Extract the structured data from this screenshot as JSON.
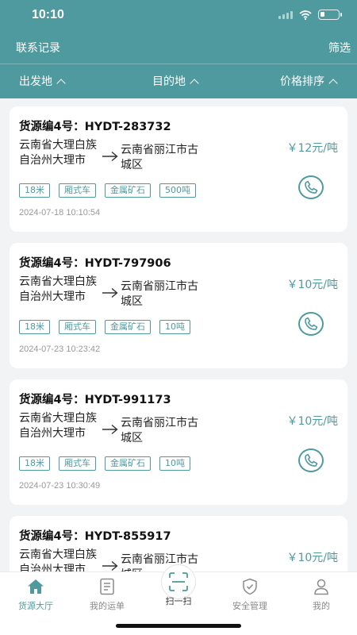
{
  "status_bar": {
    "time": "10:10"
  },
  "nav": {
    "left": "联系记录",
    "right": "筛选"
  },
  "filters": [
    {
      "label": "出发地"
    },
    {
      "label": "目的地"
    },
    {
      "label": "价格排序"
    }
  ],
  "cards": [
    {
      "title": "货源编4号：HYDT-283732",
      "origin": "云南省大理白族自治州大理市",
      "destination": "云南省丽江市古城区",
      "price": "￥12元/吨",
      "tags": [
        "18米",
        "厢式车",
        "金属矿石",
        "500吨"
      ],
      "time": "2024-07-18 10:10:54"
    },
    {
      "title": "货源编4号：HYDT-797906",
      "origin": "云南省大理白族自治州大理市",
      "destination": "云南省丽江市古城区",
      "price": "￥10元/吨",
      "tags": [
        "18米",
        "厢式车",
        "金属矿石",
        "10吨"
      ],
      "time": "2024-07-23 10:23:42"
    },
    {
      "title": "货源编4号：HYDT-991173",
      "origin": "云南省大理白族自治州大理市",
      "destination": "云南省丽江市古城区",
      "price": "￥10元/吨",
      "tags": [
        "18米",
        "厢式车",
        "金属矿石",
        "10吨"
      ],
      "time": "2024-07-23 10:30:49"
    },
    {
      "title": "货源编4号：HYDT-855917",
      "origin": "云南省大理白族自治州大理市",
      "destination": "云南省丽江市古城区",
      "price": "￥10元/吨",
      "tags": [],
      "time": ""
    }
  ],
  "tabbar": {
    "items": [
      {
        "label": "货源大厅",
        "icon": "home-icon",
        "active": true
      },
      {
        "label": "我的运单",
        "icon": "document-icon",
        "active": false
      },
      {
        "label": "扫一扫",
        "icon": "scan-icon",
        "active": false
      },
      {
        "label": "安全管理",
        "icon": "shield-icon",
        "active": false
      },
      {
        "label": "我的",
        "icon": "person-icon",
        "active": false
      }
    ]
  },
  "colors": {
    "accent": "#4f9a9f",
    "background": "#f2f3f5",
    "inactive": "#8a8a8a"
  }
}
